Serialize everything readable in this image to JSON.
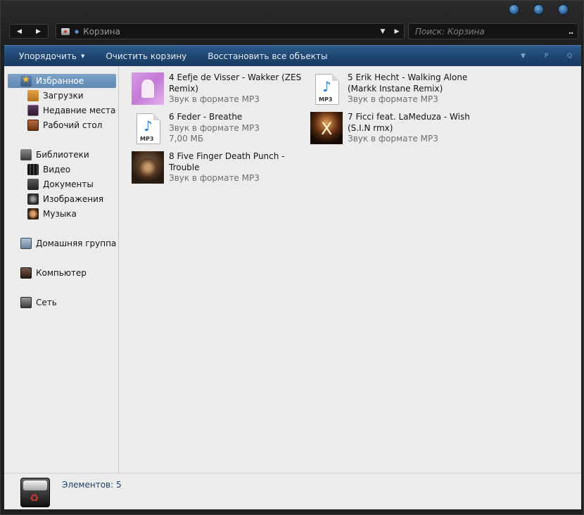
{
  "address": {
    "location": "Корзина",
    "separator_icon": "separator-icon"
  },
  "search": {
    "placeholder": "Поиск: Корзина"
  },
  "toolbar": {
    "organize": "Упорядочить",
    "empty_bin": "Очистить корзину",
    "restore_all": "Восстановить все объекты"
  },
  "sidebar": {
    "favorites": {
      "label": "Избранное",
      "items": [
        {
          "label": "Загрузки"
        },
        {
          "label": "Недавние места"
        },
        {
          "label": "Рабочий стол"
        }
      ]
    },
    "libraries": {
      "label": "Библиотеки",
      "items": [
        {
          "label": "Видео"
        },
        {
          "label": "Документы"
        },
        {
          "label": "Изображения"
        },
        {
          "label": "Музыка"
        }
      ]
    },
    "homegroup": {
      "label": "Домашняя группа"
    },
    "computer": {
      "label": "Компьютер"
    },
    "network": {
      "label": "Сеть"
    }
  },
  "files": [
    {
      "name": "4 Eefje de Visser - Wakker (ZES Remix)",
      "type": "Звук в формате MP3",
      "thumb": "album-art"
    },
    {
      "name": "5 Erik Hecht - Walking Alone (Markk Instane Remix)",
      "type": "Звук в формате MP3",
      "thumb": "mp3-file-icon"
    },
    {
      "name": "6 Feder - Breathe",
      "type": "Звук в формате MP3",
      "size": "7,00 МБ",
      "thumb": "mp3-file-icon"
    },
    {
      "name": "7 Ficci feat. LaMeduza - Wish (S.I.N rmx)",
      "type": "Звук в формате MP3",
      "thumb": "album-art"
    },
    {
      "name": "8 Five Finger Death Punch - Trouble",
      "type": "Звук в формате MP3",
      "thumb": "album-art"
    }
  ],
  "mp3_label": "MP3",
  "details": {
    "count_label": "Элементов: 5"
  }
}
